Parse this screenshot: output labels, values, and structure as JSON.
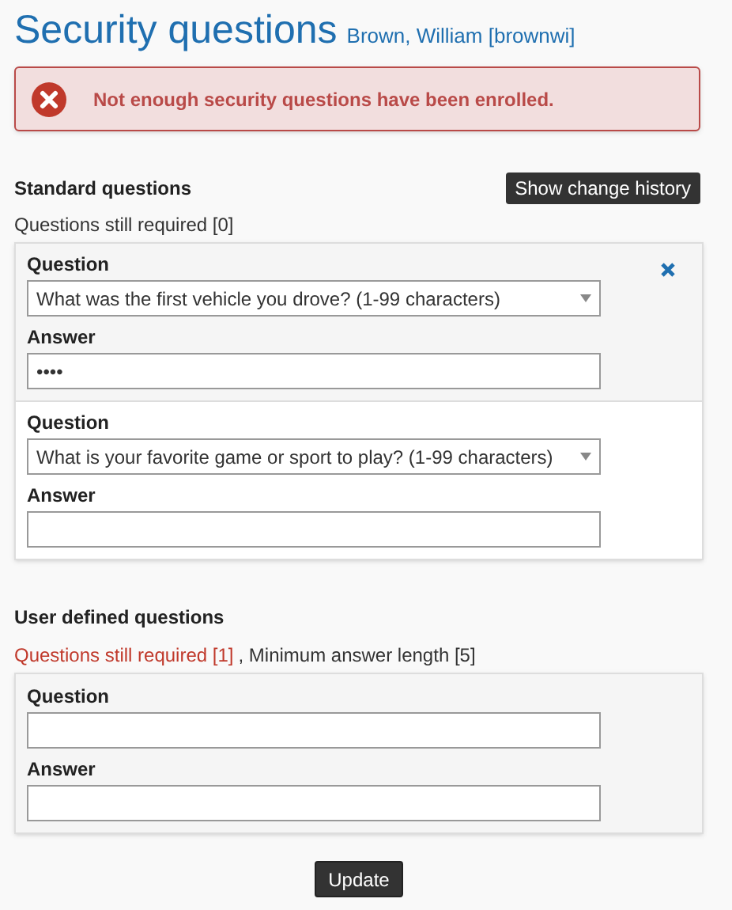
{
  "page_title": "Security questions",
  "user": "Brown, William [brownwi]",
  "alert": {
    "kind": "error",
    "message": "Not enough security questions have been enrolled."
  },
  "standard": {
    "heading": "Standard questions",
    "history_button": "Show change history",
    "required_note": "Questions still required [0]",
    "items": [
      {
        "question_label": "Question",
        "question": "What was the first vehicle you drove? (1-99 characters)",
        "answer_label": "Answer",
        "answer": "••••",
        "highlighted": true,
        "removable": true
      },
      {
        "question_label": "Question",
        "question": "What is your favorite game or sport to play? (1-99 characters)",
        "answer_label": "Answer",
        "highlighted": false,
        "removable": false
      }
    ]
  },
  "user_defined": {
    "heading": "User defined questions",
    "required_note": "Questions still required [1]",
    "required_unmet": true,
    "min_note": ", Minimum answer length [5]",
    "items": [
      {
        "question_label": "Question",
        "answer_label": "Answer"
      }
    ]
  },
  "update_button": "Update"
}
